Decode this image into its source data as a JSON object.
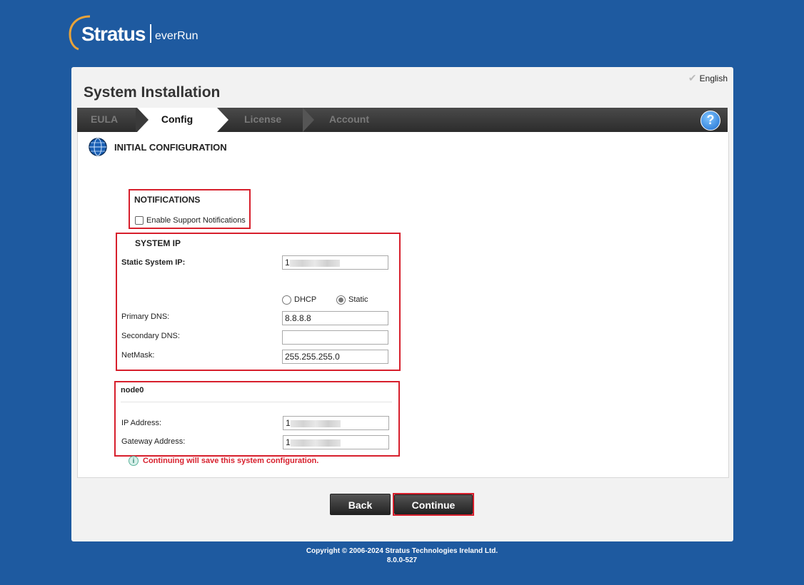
{
  "brand": {
    "name": "Stratus",
    "product": "everRun"
  },
  "header": {
    "language": "English",
    "title": "System Installation"
  },
  "steps": [
    {
      "label": "EULA",
      "state": "done"
    },
    {
      "label": "Config",
      "state": "active"
    },
    {
      "label": "License",
      "state": "pending"
    },
    {
      "label": "Account",
      "state": "pending"
    }
  ],
  "help_icon": "?",
  "section": {
    "title": "INITIAL CONFIGURATION"
  },
  "notifications": {
    "title": "NOTIFICATIONS",
    "checkbox_label": "Enable Support Notifications",
    "checked": false
  },
  "system_ip": {
    "title": "SYSTEM IP",
    "static_ip_label": "Static System IP:",
    "static_ip_value": "1",
    "mode_options": [
      "DHCP",
      "Static"
    ],
    "mode_selected": "Static",
    "primary_dns_label": "Primary DNS:",
    "primary_dns_value": "8.8.8.8",
    "secondary_dns_label": "Secondary DNS:",
    "secondary_dns_value": "",
    "netmask_label": "NetMask:",
    "netmask_value": "255.255.255.0"
  },
  "node": {
    "title": "node0",
    "ip_label": "IP Address:",
    "ip_value": "1",
    "gateway_label": "Gateway Address:",
    "gateway_value": "1"
  },
  "warning": "Continuing will save this system configuration.",
  "buttons": {
    "back": "Back",
    "continue": "Continue"
  },
  "footer": {
    "copyright": "Copyright © 2006-2024 Stratus Technologies Ireland Ltd.",
    "version": "8.0.0-527"
  },
  "colors": {
    "background": "#1e5aa0",
    "accent_red": "#d71f2c",
    "logo_arc": "#e8a33a"
  }
}
